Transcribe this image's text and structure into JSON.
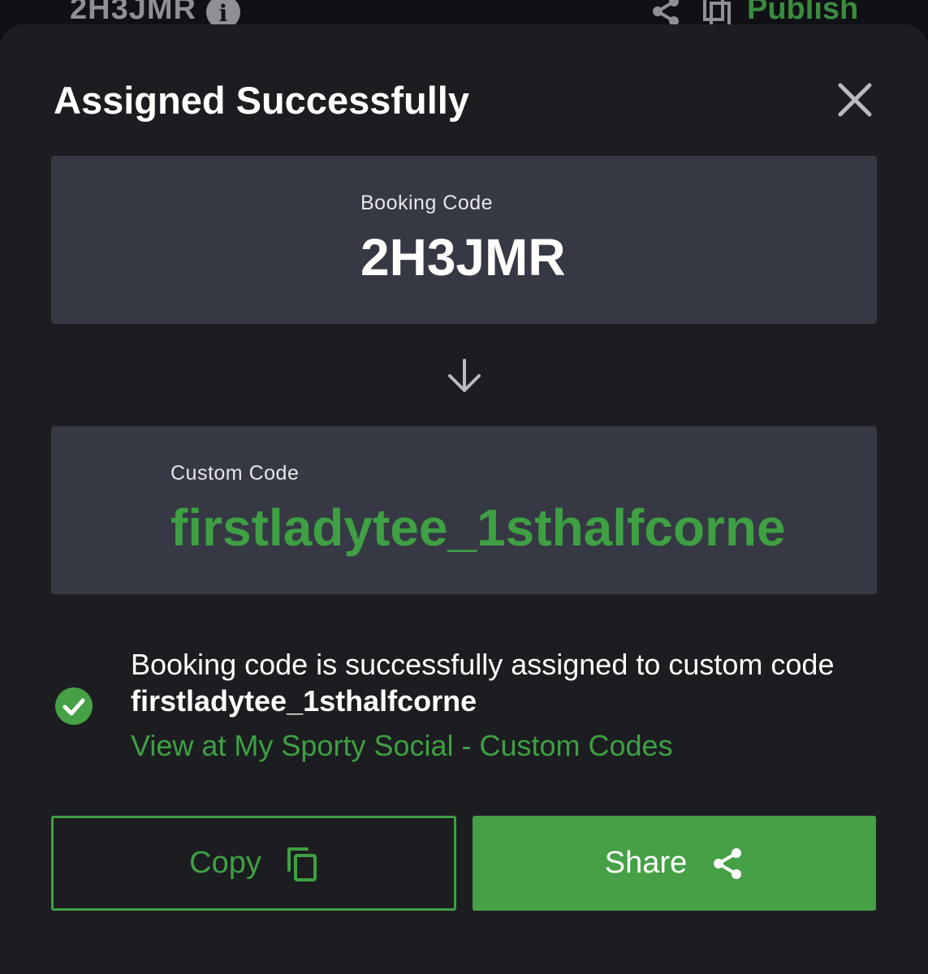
{
  "background_header": {
    "code": "2H3JMR",
    "info_icon": "info-icon",
    "share_icon": "share-icon",
    "copy_icon": "copy-icon",
    "publish_label": "Publish"
  },
  "modal": {
    "title": "Assigned Successfully",
    "close_icon": "close-icon",
    "booking": {
      "label": "Booking Code",
      "value": "2H3JMR"
    },
    "arrow_icon": "arrow-down-icon",
    "custom": {
      "label": "Custom Code",
      "value": "firstladytee_1sthalfcorne"
    },
    "success": {
      "icon": "check-circle-icon",
      "message_prefix": "Booking code is successfully assigned to custom code ",
      "message_code": "firstladytee_1sthalfcorne",
      "link": "View at My Sporty Social - Custom Codes"
    },
    "buttons": {
      "copy_label": "Copy",
      "share_label": "Share"
    }
  },
  "colors": {
    "sheet_bg": "#1c1d21",
    "box_bg": "#363944",
    "accent_green": "#3ea043",
    "share_button_bg": "#46a046",
    "text": "#ffffff"
  }
}
